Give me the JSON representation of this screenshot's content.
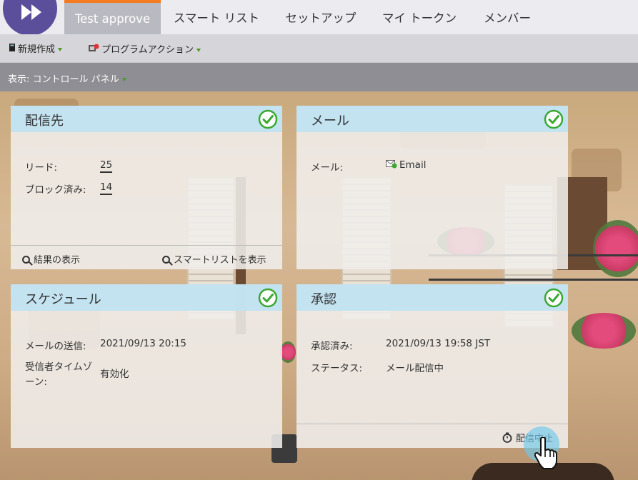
{
  "nav": {
    "tabs": [
      {
        "label": "Test approve",
        "active": true
      },
      {
        "label": "スマート リスト"
      },
      {
        "label": "セットアップ"
      },
      {
        "label": "マイ トークン"
      },
      {
        "label": "メンバー"
      }
    ]
  },
  "toolbar": {
    "new_label": "新規作成",
    "program_actions_label": "プログラムアクション"
  },
  "viewbar": {
    "label": "表示: コントロール パネル"
  },
  "panels": {
    "audience": {
      "title": "配信先",
      "rows": [
        {
          "label": "リード:",
          "value": "25"
        },
        {
          "label": "ブロック済み:",
          "value": "14"
        }
      ],
      "view_results": "結果の表示",
      "view_smartlist": "スマートリストを表示"
    },
    "email": {
      "title": "メール",
      "label": "メール:",
      "value": "Email"
    },
    "schedule": {
      "title": "スケジュール",
      "send_label": "メールの送信:",
      "send_value": "2021/09/13 20:15",
      "tz_label_line1": "受信者タイムゾ",
      "tz_label_line2": "ーン:",
      "tz_value": "有効化"
    },
    "approval": {
      "title": "承認",
      "approved_label": "承認済み:",
      "approved_value": "2021/09/13 19:58 JST",
      "status_label": "ステータス:",
      "status_value": "メール配信中",
      "stop_label": "配信中止"
    }
  },
  "colors": {
    "accent_orange": "#f47b20",
    "panel_header": "#c1e3f1",
    "check_green": "#3aa832",
    "logo_purple": "#5b4f9b"
  }
}
